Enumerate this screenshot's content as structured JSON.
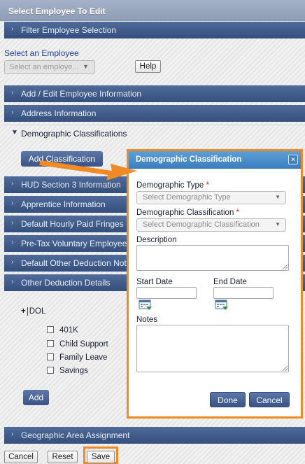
{
  "header": {
    "title": "Select Employee To Edit"
  },
  "sections": {
    "filter": "Filter Employee Selection",
    "add_edit": "Add / Edit Employee Information",
    "address": "Address Information",
    "demographic": "Demographic Classifications",
    "hud": "HUD Section 3 Information",
    "apprentice": "Apprentice Information",
    "default_hourly": "Default Hourly Paid Fringes (As",
    "pretax": "Pre-Tax Voluntary Employee Co",
    "default_other": "Default Other Deduction Notes",
    "other_details": "Other Deduction Details",
    "geographic": "Geographic Area Assignment"
  },
  "employee": {
    "label": "Select an Employee",
    "placeholder": "Select an employe...",
    "help_label": "Help"
  },
  "demographic": {
    "add_classification_label": "Add Classification"
  },
  "deductions": {
    "group_label": "DOL",
    "items": [
      "401K",
      "Child Support",
      "Family Leave",
      "Savings"
    ],
    "add_label": "Add"
  },
  "footer": {
    "cancel_label": "Cancel",
    "reset_label": "Reset",
    "save_label": "Save"
  },
  "modal": {
    "title": "Demographic Classification",
    "type_label": "Demographic Type",
    "type_placeholder": "Select Demographic Type",
    "classification_label": "Demographic Classification",
    "classification_placeholder": "Select Demographic Classification",
    "required_marker": "*",
    "description_label": "Description",
    "start_date_label": "Start Date",
    "end_date_label": "End Date",
    "notes_label": "Notes",
    "done_label": "Done",
    "cancel_label": "Cancel",
    "close_icon": "close-icon"
  },
  "colors": {
    "section_bar": "#3f5a8a",
    "modal_header": "#4a8fcf",
    "highlight": "#f08a24",
    "required": "#dd2222"
  }
}
